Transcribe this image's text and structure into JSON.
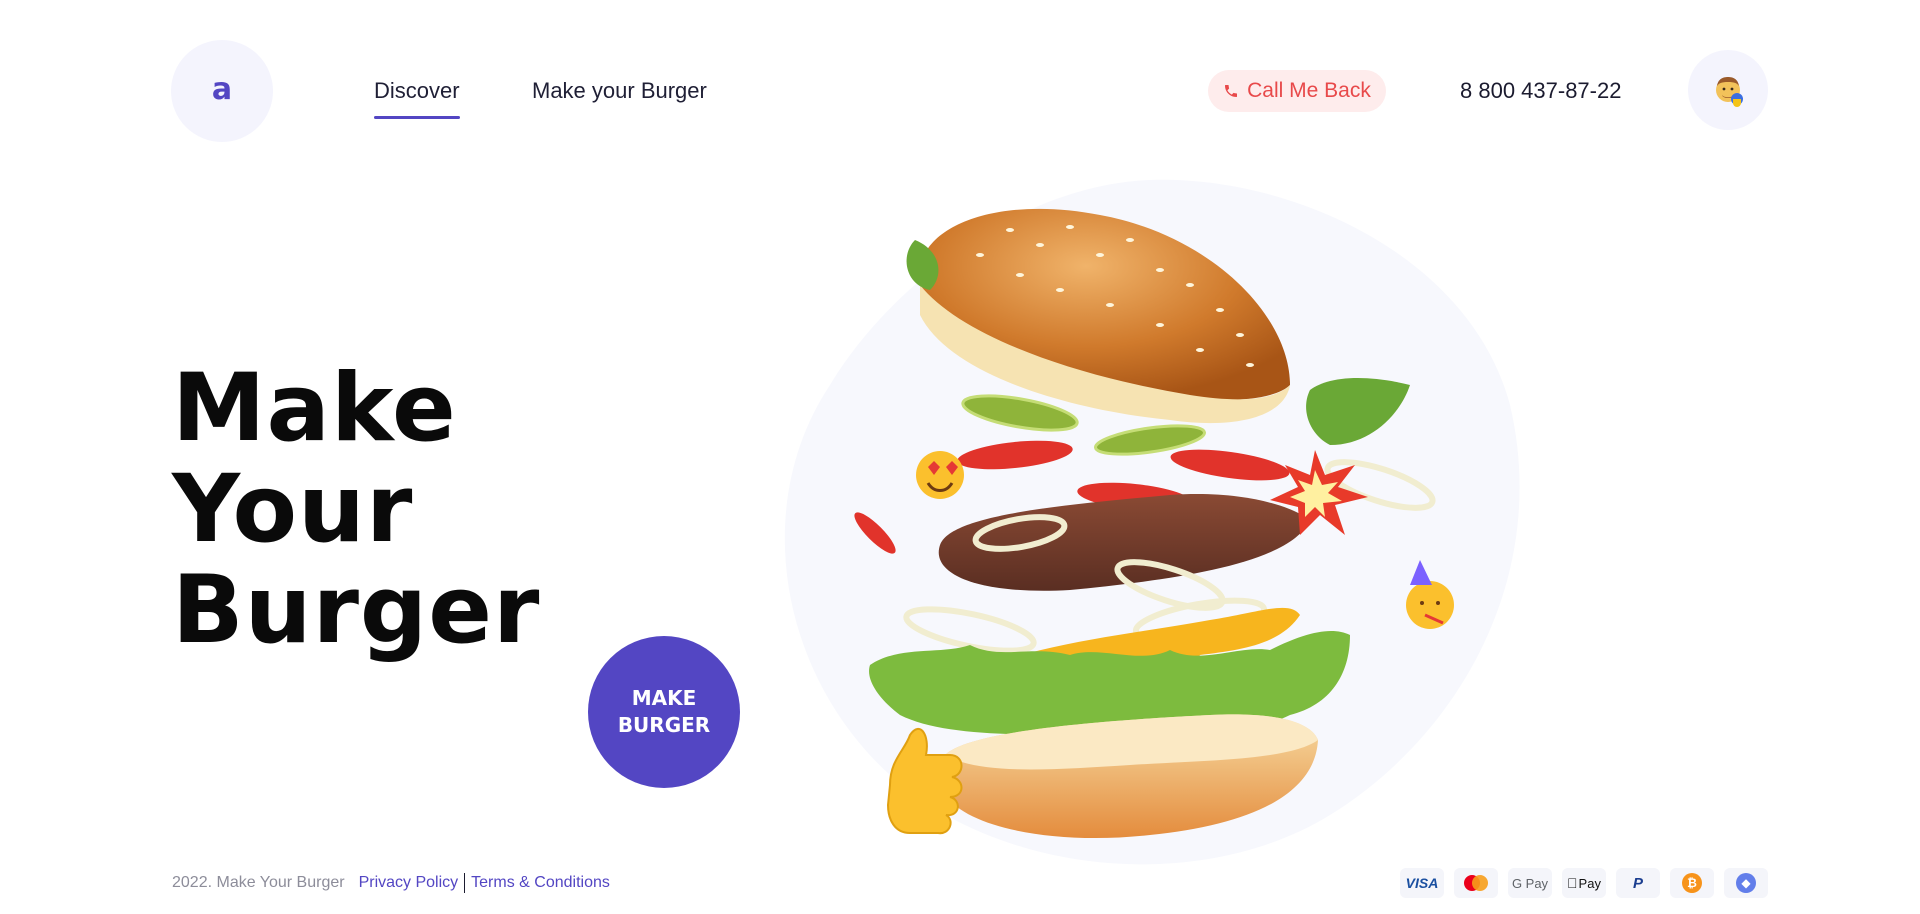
{
  "header": {
    "logo_letter": "a",
    "nav": [
      {
        "label": "Discover",
        "active": true
      },
      {
        "label": "Make your Burger",
        "active": false
      }
    ],
    "call_button_label": "Call Me Back",
    "phone_number": "8 800 437-87-22",
    "avatar_icon": "man-emoji-avatar"
  },
  "hero": {
    "title_lines": [
      "Make",
      "Your",
      "Burger"
    ],
    "cta_label": "MAKE BURGER",
    "illustration": "flying-burger-ingredients",
    "emojis": [
      "heart-eyes-emoji",
      "party-face-emoji",
      "thumbs-up-emoji"
    ]
  },
  "footer": {
    "copyright": "2022. Make Your Burger",
    "privacy_label": "Privacy Policy",
    "terms_label": "Terms & Conditions",
    "payments": [
      {
        "name": "visa-icon",
        "label": "VISA"
      },
      {
        "name": "mastercard-icon",
        "label": ""
      },
      {
        "name": "google-pay-icon",
        "label": "G Pay"
      },
      {
        "name": "apple-pay-icon",
        "label": "Pay"
      },
      {
        "name": "paypal-icon",
        "label": "P"
      },
      {
        "name": "bitcoin-icon",
        "label": "₿"
      },
      {
        "name": "ethereum-icon",
        "label": "◆"
      }
    ]
  },
  "colors": {
    "accent": "#5346c3",
    "call_bg": "#feecec",
    "call_text": "#e8494a",
    "blob_bg": "#f7f8fd"
  }
}
